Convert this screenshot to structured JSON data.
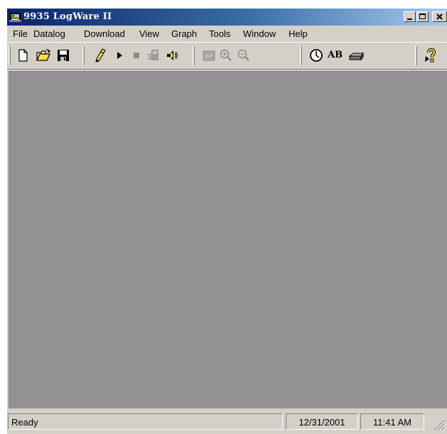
{
  "window": {
    "title": "9935 LogWare II",
    "controls": [
      "minimize",
      "maximize",
      "close"
    ]
  },
  "menu": {
    "items": [
      {
        "label": "File"
      },
      {
        "label": "Datalog"
      },
      {
        "label": "Download"
      },
      {
        "label": "View"
      },
      {
        "label": "Graph"
      },
      {
        "label": "Tools"
      },
      {
        "label": "Window"
      },
      {
        "label": "Help"
      }
    ]
  },
  "toolbar": {
    "buttons": [
      {
        "icon": "new-file-icon"
      },
      {
        "icon": "open-folder-icon"
      },
      {
        "icon": "save-icon"
      },
      {
        "icon": "pencil-icon"
      },
      {
        "icon": "play-icon"
      },
      {
        "icon": "stop-icon"
      },
      {
        "icon": "logger-icon"
      },
      {
        "icon": "speaker-icon"
      },
      {
        "icon": "graph-icon"
      },
      {
        "icon": "zoom-in-icon"
      },
      {
        "icon": "zoom-out-icon"
      },
      {
        "icon": "clock-icon"
      },
      {
        "icon": "ab-icon",
        "label": "AB"
      },
      {
        "icon": "device-icon"
      },
      {
        "icon": "help-icon"
      }
    ]
  },
  "statusbar": {
    "status": "Ready",
    "date": "12/31/2001",
    "time": "11:41 AM"
  },
  "colors": {
    "titlebar_start": "#0a246a",
    "titlebar_end": "#a6caf0",
    "workspace": "#939194",
    "chrome": "#d4d0c8"
  }
}
